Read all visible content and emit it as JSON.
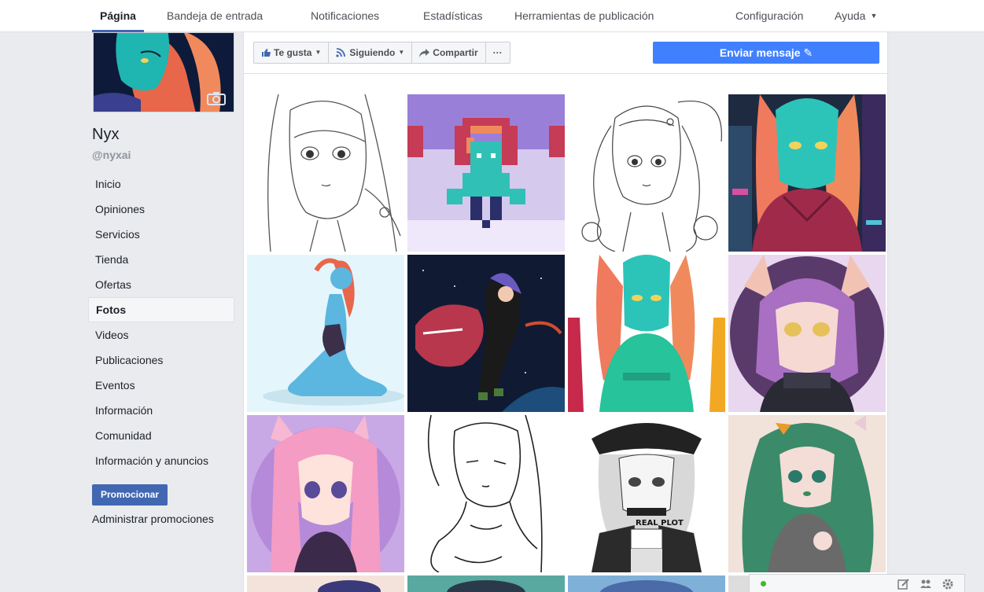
{
  "nav": {
    "page": "Página",
    "inbox": "Bandeja de entrada",
    "notifications": "Notificaciones",
    "stats": "Estadísticas",
    "publishing_tools": "Herramientas de publicación",
    "settings": "Configuración",
    "help": "Ayuda"
  },
  "profile": {
    "name": "Nyx",
    "handle": "@nyxai"
  },
  "menu": [
    {
      "label": "Inicio"
    },
    {
      "label": "Opiniones"
    },
    {
      "label": "Servicios"
    },
    {
      "label": "Tienda"
    },
    {
      "label": "Ofertas"
    },
    {
      "label": "Fotos"
    },
    {
      "label": "Videos"
    },
    {
      "label": "Publicaciones"
    },
    {
      "label": "Eventos"
    },
    {
      "label": "Información"
    },
    {
      "label": "Comunidad"
    },
    {
      "label": "Información y anuncios"
    }
  ],
  "promote_label": "Promocionar",
  "admin_promotions": "Administrar promociones",
  "actions": {
    "like": "Te gusta",
    "following": "Siguiendo",
    "share": "Compartir",
    "more": "···",
    "send_message": "Enviar mensaje"
  },
  "photos": [
    {
      "name": "photo-sketch-girl",
      "caption": ""
    },
    {
      "name": "photo-pixel-art",
      "caption": ""
    },
    {
      "name": "photo-sketch-curly",
      "caption": ""
    },
    {
      "name": "photo-hoodie-neon",
      "caption": ""
    },
    {
      "name": "photo-seated-figure",
      "caption": ""
    },
    {
      "name": "photo-space-shark",
      "caption": ""
    },
    {
      "name": "photo-hoodie-variants",
      "caption": ""
    },
    {
      "name": "photo-purple-catgirl",
      "caption": ""
    },
    {
      "name": "photo-pink-catgirl",
      "caption": ""
    },
    {
      "name": "photo-lineart-portrait",
      "caption": ""
    },
    {
      "name": "photo-real-plot",
      "caption": "REAL PLOT"
    },
    {
      "name": "photo-green-hair",
      "caption": ""
    }
  ],
  "colors": {
    "accent": "#4267b2",
    "send_button": "#4080ff",
    "background": "#e9ebee",
    "online": "#42b72a"
  }
}
